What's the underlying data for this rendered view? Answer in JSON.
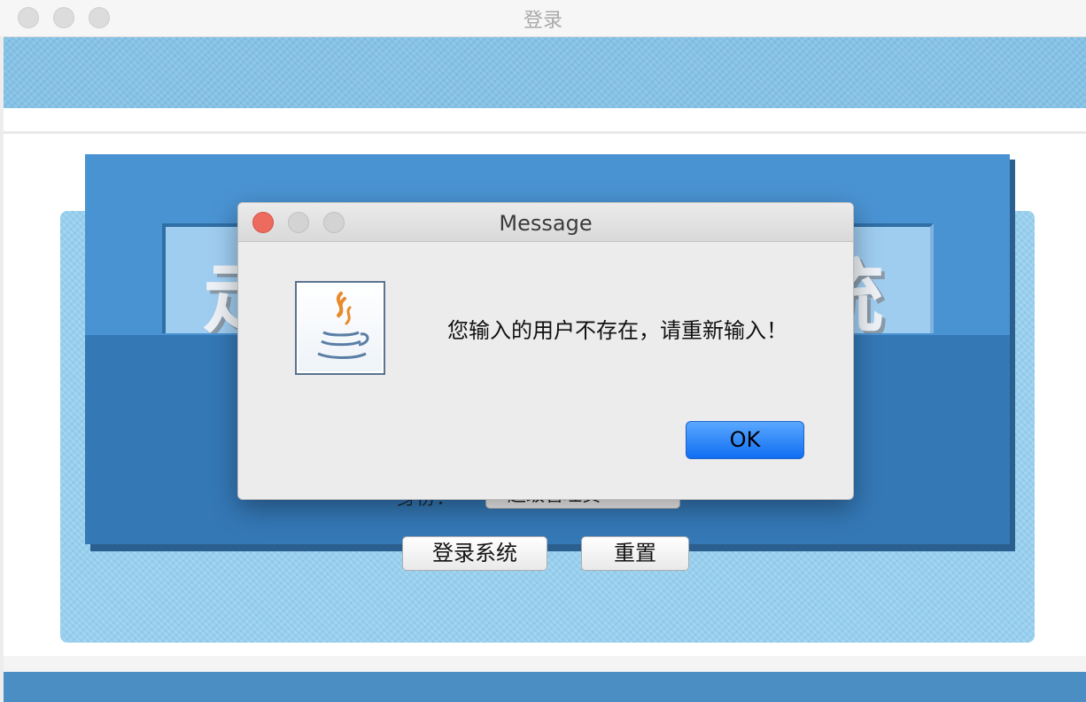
{
  "window": {
    "title": "登录",
    "traffic_lights": [
      "close",
      "minimize",
      "maximize"
    ]
  },
  "login_form": {
    "logo_text_left": "走",
    "logo_text_right": "统",
    "identity_label": "身份：",
    "identity_value": "超级管理员",
    "login_button": "登录系统",
    "reset_button": "重置"
  },
  "dialog": {
    "title": "Message",
    "icon": "java-cup-icon",
    "message": "您输入的用户不存在，请重新输入！",
    "ok_label": "OK",
    "ok_color": "#1a7cf7"
  },
  "colors": {
    "banner": "#85c2e6",
    "panel": "#97cfee",
    "frame": "#3478b6",
    "close": "#ed6a5e"
  }
}
